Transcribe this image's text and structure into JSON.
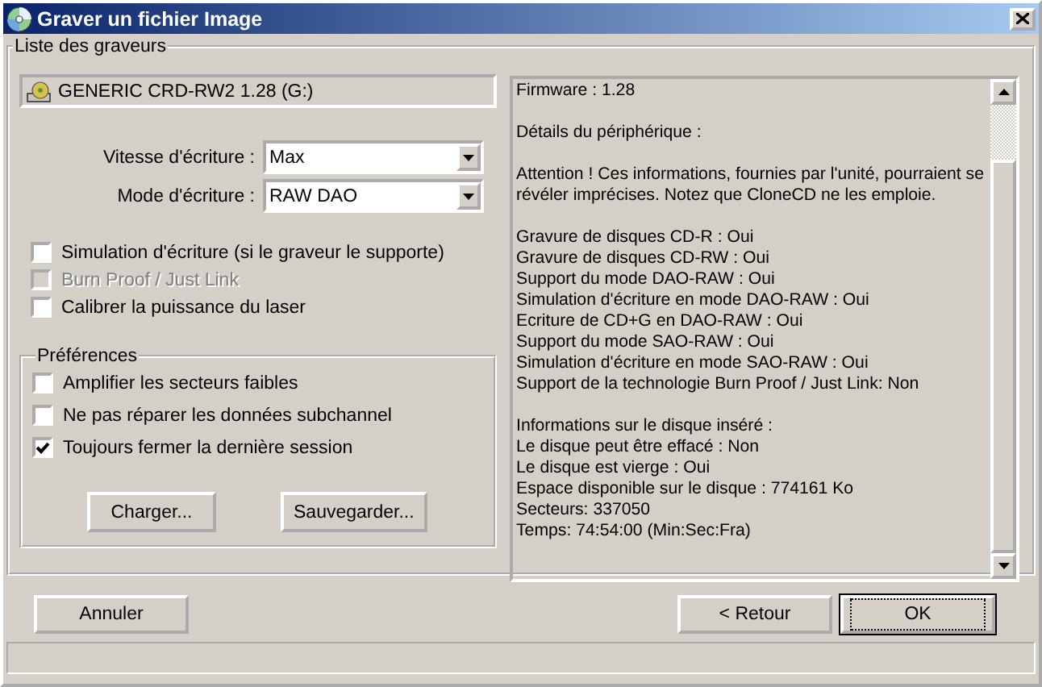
{
  "window": {
    "title": "Graver un fichier Image"
  },
  "writers": {
    "legend": "Liste des graveurs",
    "drive": "GENERIC CRD-RW2 1.28 (G:)",
    "fields": [
      {
        "label": "Vitesse d'écriture :",
        "value": "Max"
      },
      {
        "label": "Mode d'écriture :",
        "value": "RAW DAO"
      }
    ],
    "options": [
      {
        "label": "Simulation d'écriture (si le graveur le supporte)",
        "checked": false,
        "disabled": false
      },
      {
        "label": "Burn Proof / Just Link",
        "checked": false,
        "disabled": true
      },
      {
        "label": "Calibrer la puissance du laser",
        "checked": false,
        "disabled": false
      }
    ]
  },
  "preferences": {
    "legend": "Préférences",
    "options": [
      {
        "label": "Amplifier les secteurs faibles",
        "checked": false,
        "disabled": false
      },
      {
        "label": "Ne pas réparer les données subchannel",
        "checked": false,
        "disabled": false
      },
      {
        "label": "Toujours fermer la dernière session",
        "checked": true,
        "disabled": false
      }
    ],
    "buttons": [
      "Charger...",
      "Sauvegarder..."
    ]
  },
  "info": {
    "paragraphs": [
      [
        "Firmware : 1.28"
      ],
      [
        "Détails du périphérique :"
      ],
      [
        "Attention ! Ces informations, fournies par l'unité, pourraient se révéler imprécises. Notez que CloneCD ne les emploie."
      ],
      [
        "Gravure de disques CD-R : Oui",
        "Gravure de disques CD-RW : Oui",
        "Support du mode DAO-RAW : Oui",
        "Simulation d'écriture en mode DAO-RAW : Oui",
        "Ecriture de CD+G en DAO-RAW : Oui",
        "Support du mode SAO-RAW : Oui",
        "Simulation d'écriture en mode SAO-RAW : Oui",
        "Support de la technologie Burn Proof / Just Link: Non"
      ],
      [
        "Informations sur le disque inséré :",
        "Le disque peut être effacé : Non",
        "Le disque est vierge : Oui",
        "Espace disponible sur le disque : 774161 Ko",
        "Secteurs: 337050",
        "Temps: 74:54:00 (Min:Sec:Fra)"
      ]
    ]
  },
  "buttons": [
    {
      "label": "Annuler",
      "kind": "cancel"
    },
    {
      "label": "< Retour",
      "kind": "back"
    },
    {
      "label": "OK",
      "kind": "default"
    }
  ]
}
